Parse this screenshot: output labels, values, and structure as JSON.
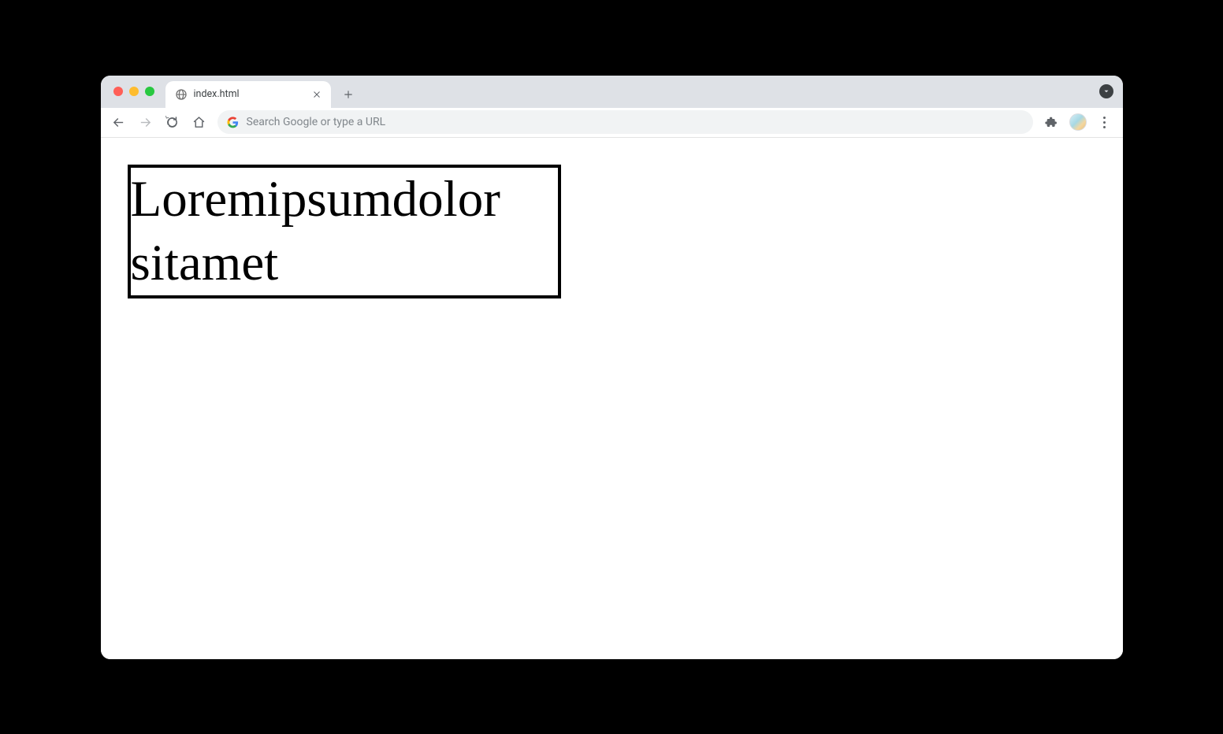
{
  "browser": {
    "tabs": [
      {
        "title": "index.html"
      }
    ],
    "omnibox_placeholder": "Search Google or type a URL"
  },
  "page": {
    "box_text": "Loremipsumdolor sitamet"
  }
}
